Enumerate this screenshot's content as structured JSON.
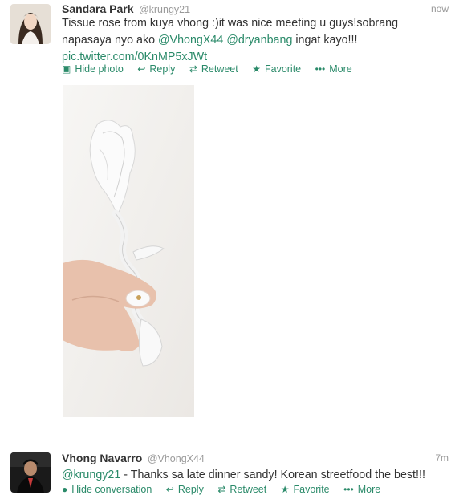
{
  "tweets": [
    {
      "name": "Sandara Park",
      "handle": "@krungy21",
      "time": "now",
      "text_parts": {
        "t1": "Tissue rose from kuya vhong :)it was nice meeting u guys!sobrang napasaya nyo ako ",
        "m1": "@VhongX44",
        "t2": " ",
        "m2": "@dryanbang",
        "t3": " ingat kayo!!! ",
        "link": "pic.twitter.com/0KnMP5xJWt"
      },
      "actions": {
        "toggle": "Hide photo",
        "reply": "Reply",
        "retweet": "Retweet",
        "favorite": "Favorite",
        "more": "More"
      }
    },
    {
      "name": "Vhong Navarro",
      "handle": "@VhongX44",
      "time": "7m",
      "text_parts": {
        "m1": "@krungy21",
        "t1": " -  Thanks sa late dinner sandy! Korean streetfood the best!!!"
      },
      "actions": {
        "toggle": "Hide conversation",
        "reply": "Reply",
        "retweet": "Retweet",
        "favorite": "Favorite",
        "more": "More"
      }
    }
  ],
  "colors": {
    "link": "#2a8a69",
    "muted": "#999999",
    "text": "#333333"
  },
  "icons": [
    "photo-icon",
    "reply-icon",
    "retweet-icon",
    "star-icon",
    "more-icon",
    "conversation-icon"
  ]
}
